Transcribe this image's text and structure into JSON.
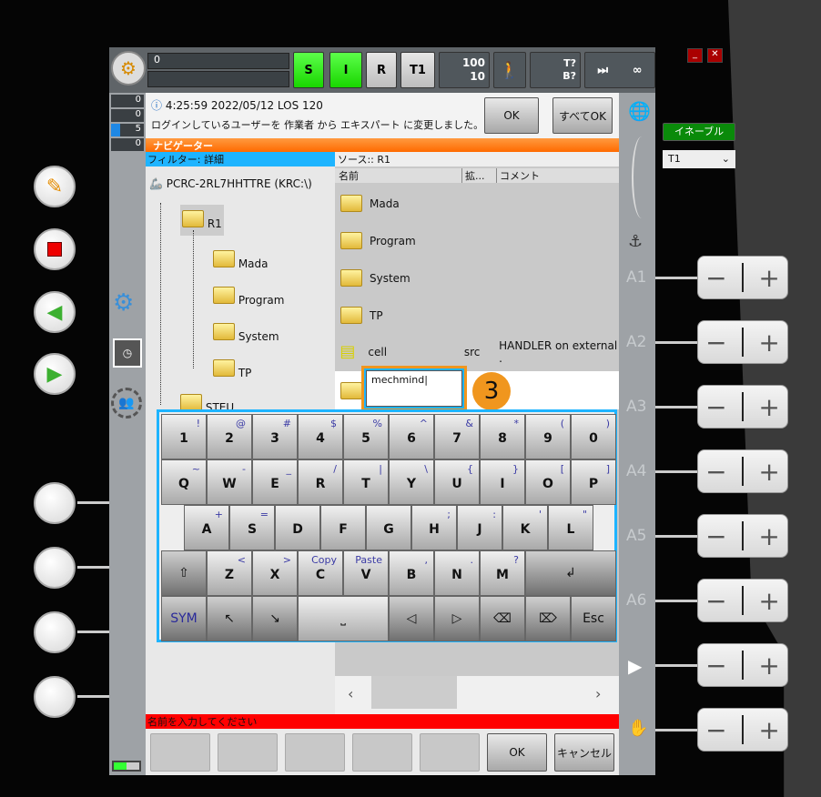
{
  "topbar": {
    "progress_value": "0",
    "status_s": "S",
    "status_i": "I",
    "status_r": "R",
    "mode": "T1",
    "override": "100",
    "jog_override": "10",
    "tool": "T?",
    "base": "B?",
    "increment": "∞",
    "colors": {
      "active": "#19d600"
    }
  },
  "messages": {
    "counts": [
      {
        "icon": "stop-msg-icon",
        "value": "0"
      },
      {
        "icon": "warning-msg-icon",
        "value": "0"
      },
      {
        "icon": "info-msg-icon",
        "value": "5"
      },
      {
        "icon": "wait-msg-icon",
        "value": "0"
      }
    ],
    "header": "4:25:59 2022/05/12 LOS 120",
    "text": "ログインしているユーザーを 作業者 から エキスパート に変更しました。",
    "ok": "OK",
    "ok_all": "すべてOK"
  },
  "navigator": {
    "title": "ナビゲーター",
    "filter": "フィルター: 詳細",
    "source": "ソース:: R1",
    "columns": [
      "名前",
      "拡...",
      "コメント"
    ],
    "tree": {
      "root": "PCRC-2RL7HHTTRE (KRC:\\)",
      "r1": "R1",
      "children": [
        "Mada",
        "Program",
        "System",
        "TP"
      ],
      "steu": "STEU"
    },
    "files": [
      {
        "name": "Mada",
        "type": "folder"
      },
      {
        "name": "Program",
        "type": "folder"
      },
      {
        "name": "System",
        "type": "folder"
      },
      {
        "name": "TP",
        "type": "folder"
      },
      {
        "name": "cell",
        "ext": "src",
        "comment": "HANDLER on external .",
        "type": "module"
      }
    ],
    "new_name_value": "mechmind",
    "step_badge": "3"
  },
  "keyboard": {
    "row1": [
      [
        "1",
        "!"
      ],
      [
        "2",
        "@"
      ],
      [
        "3",
        "#"
      ],
      [
        "4",
        "$"
      ],
      [
        "5",
        "%"
      ],
      [
        "6",
        "^"
      ],
      [
        "7",
        "&"
      ],
      [
        "8",
        "*"
      ],
      [
        "9",
        "("
      ],
      [
        "0",
        ")"
      ]
    ],
    "row2": [
      [
        "Q",
        "~"
      ],
      [
        "W",
        "-"
      ],
      [
        "E",
        "_"
      ],
      [
        "R",
        "/"
      ],
      [
        "T",
        "|"
      ],
      [
        "Y",
        "\\"
      ],
      [
        "U",
        "{"
      ],
      [
        "I",
        "}"
      ],
      [
        "O",
        "["
      ],
      [
        "P",
        "]"
      ]
    ],
    "row3": [
      [
        "A",
        "+"
      ],
      [
        "S",
        "="
      ],
      [
        "D",
        ""
      ],
      [
        "F",
        ""
      ],
      [
        "G",
        ""
      ],
      [
        "H",
        ";"
      ],
      [
        "J",
        ":"
      ],
      [
        "K",
        "'"
      ],
      [
        "L",
        "\""
      ]
    ],
    "row4": [
      [
        "Z",
        "<"
      ],
      [
        "X",
        ">"
      ],
      [
        "C",
        "Copy"
      ],
      [
        "V",
        "Paste"
      ],
      [
        "B",
        ","
      ],
      [
        "N",
        "."
      ],
      [
        "M",
        "?"
      ]
    ],
    "shift": "⇧",
    "enter": "↲",
    "sym": "SYM",
    "home": "↖",
    "end": "↘",
    "space": "⎵",
    "left": "◁",
    "right": "▷",
    "backspace": "⌫",
    "delete": "⌦",
    "esc": "Esc"
  },
  "status_bar": {
    "message": "名前を入力してください",
    "color": "#ff0000"
  },
  "softkeys": {
    "ok": "OK",
    "cancel": "キャンセル"
  },
  "right": {
    "enable": "イネーブル",
    "mode_select": "T1",
    "axes": [
      "A1",
      "A2",
      "A3",
      "A4",
      "A5",
      "A6"
    ]
  }
}
